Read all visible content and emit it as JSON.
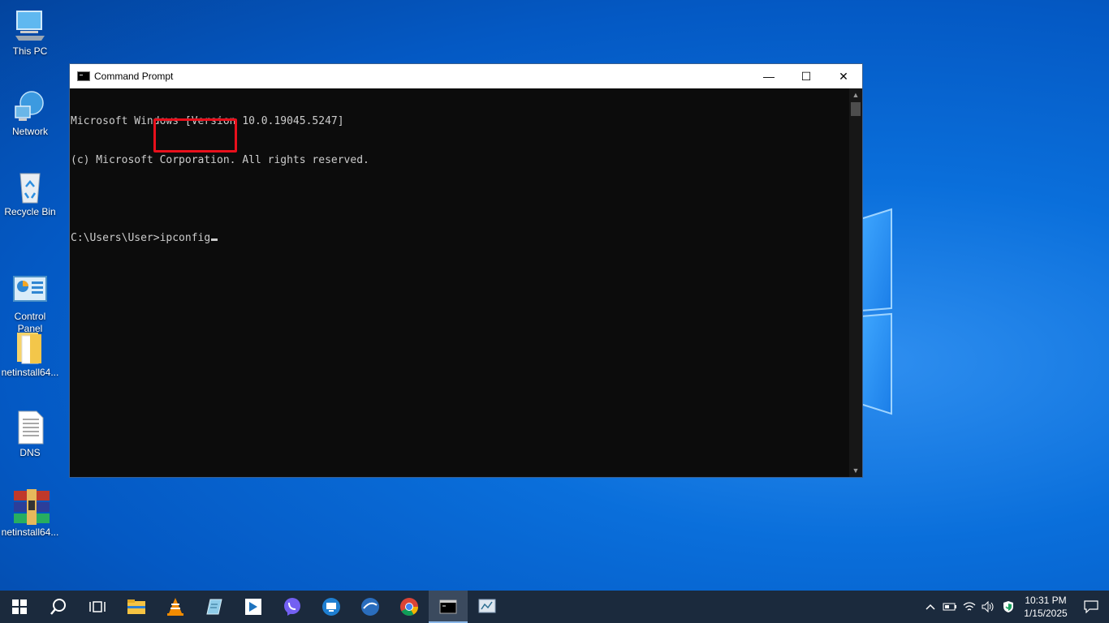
{
  "desktop": {
    "icons": [
      {
        "label": "This PC"
      },
      {
        "label": "Network"
      },
      {
        "label": "Recycle Bin"
      },
      {
        "label": "Control\nPanel"
      },
      {
        "label": "netinstall64..."
      },
      {
        "label": "DNS"
      },
      {
        "label": "netinstall64..."
      }
    ]
  },
  "window": {
    "title": "Command Prompt",
    "minimize_glyph": "—",
    "maximize_glyph": "☐",
    "close_glyph": "✕",
    "console_lines": [
      "Microsoft Windows [Version 10.0.19045.5247]",
      "(c) Microsoft Corporation. All rights reserved.",
      "",
      "C:\\Users\\User>ipconfig"
    ]
  },
  "taskbar": {
    "apps": [
      "start-icon",
      "search-icon",
      "task-view-icon",
      "file-explorer-icon",
      "vlc-icon",
      "notepad-icon",
      "remote-desktop-icon",
      "viber-icon",
      "teamviewer-icon",
      "winbox-icon",
      "chrome-icon",
      "command-prompt-icon",
      "network-tool-icon"
    ],
    "clock_time": "10:31 PM",
    "clock_date": "1/15/2025"
  },
  "colors": {
    "highlight": "#e8101c",
    "console_bg": "#0c0c0c",
    "taskbar_bg": "#1b2a3d"
  }
}
